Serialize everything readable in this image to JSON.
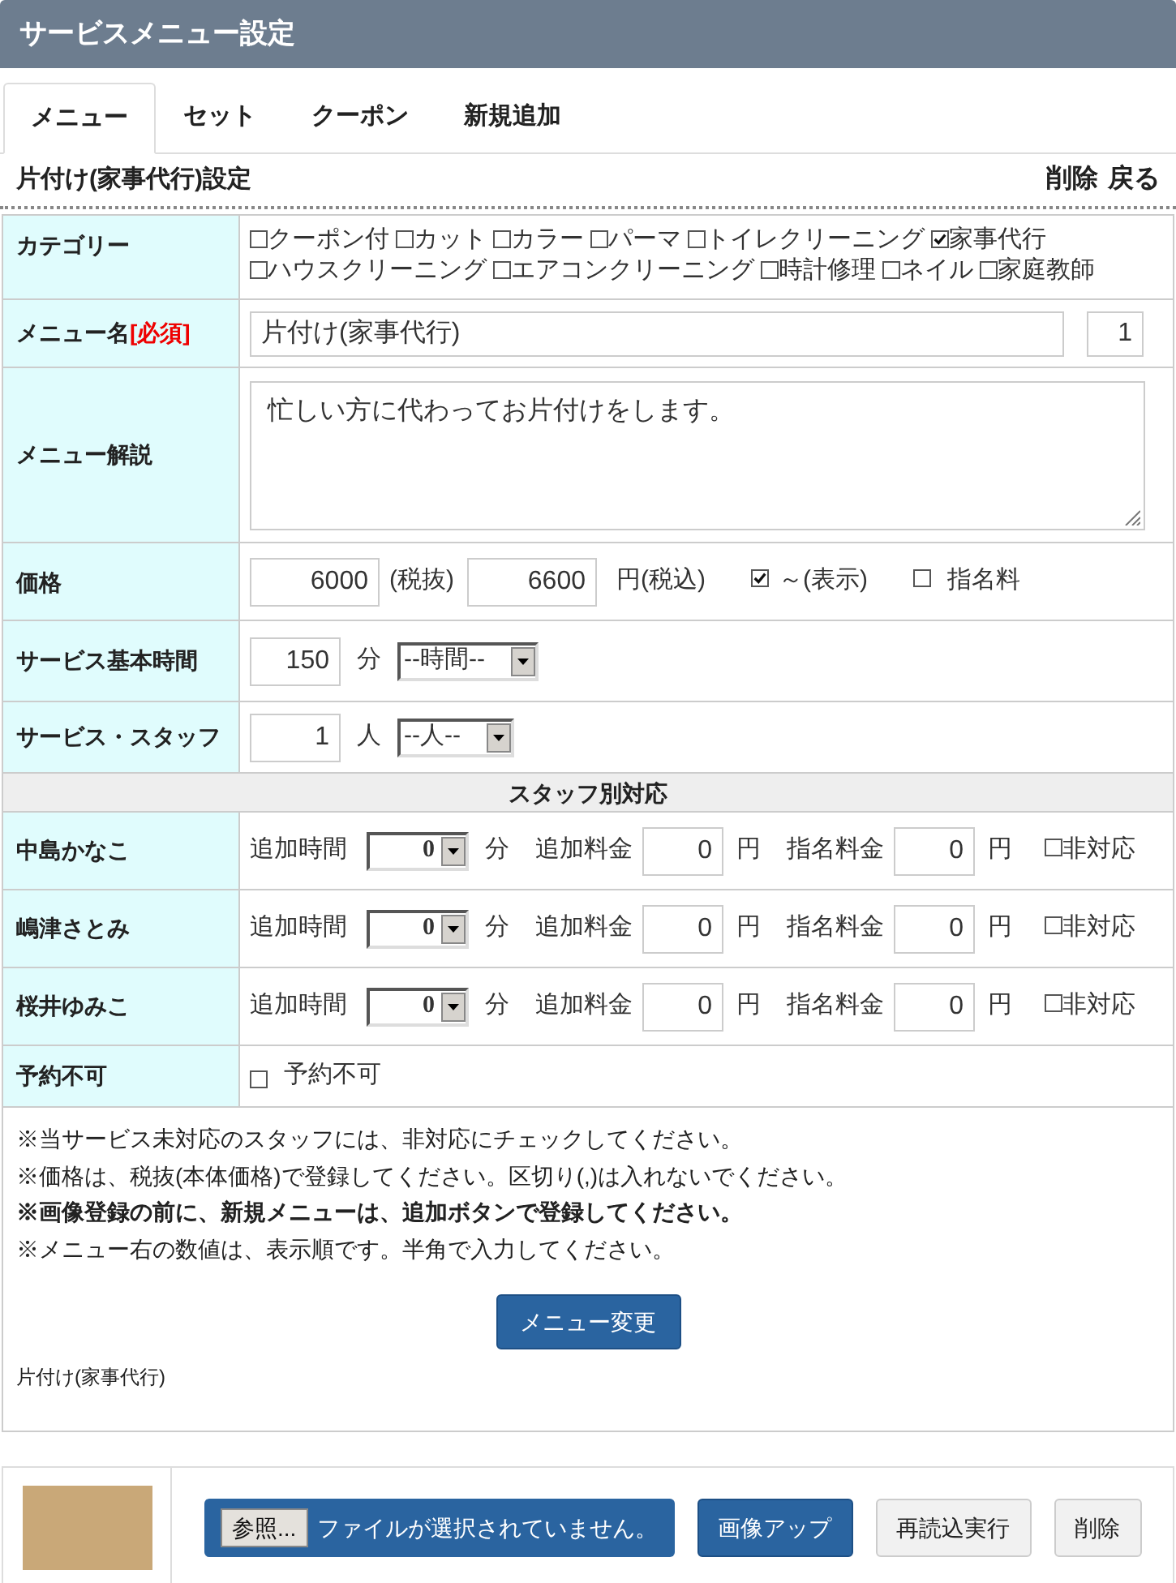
{
  "header": {
    "title": "サービスメニュー設定"
  },
  "tabs": [
    {
      "label": "メニュー",
      "selected": true
    },
    {
      "label": "セット",
      "selected": false
    },
    {
      "label": "クーポン",
      "selected": false
    },
    {
      "label": "新規追加",
      "selected": false
    }
  ],
  "section": {
    "title": "片付け(家事代行)設定",
    "actions": [
      "削除",
      "戻る"
    ]
  },
  "category": {
    "label": "カテゴリー",
    "options": [
      {
        "label": "クーポン付",
        "checked": false
      },
      {
        "label": "カット",
        "checked": false
      },
      {
        "label": "カラー",
        "checked": false
      },
      {
        "label": "パーマ",
        "checked": false
      },
      {
        "label": "トイレクリーニング",
        "checked": false
      },
      {
        "label": "家事代行",
        "checked": true
      },
      {
        "label": "ハウスクリーニング",
        "checked": false
      },
      {
        "label": "エアコンクリーニング",
        "checked": false
      },
      {
        "label": "時計修理",
        "checked": false
      },
      {
        "label": "ネイル",
        "checked": false
      },
      {
        "label": "家庭教師",
        "checked": false
      }
    ]
  },
  "menu_name": {
    "label": "メニュー名",
    "required_tag": "[必須]",
    "value": "片付け(家事代行)",
    "order": "1"
  },
  "description": {
    "label": "メニュー解説",
    "value": "忙しい方に代わってお片付けをします。"
  },
  "price": {
    "label": "価格",
    "excl_value": "6000",
    "excl_unit": "(税抜)",
    "incl_value": "6600",
    "incl_unit": "円(税込)",
    "range_display": {
      "label": "～(表示)",
      "checked": true
    },
    "nomination": {
      "label": "指名料",
      "checked": false
    }
  },
  "base_time": {
    "label": "サービス基本時間",
    "value": "150",
    "unit": "分",
    "select": "--時間--"
  },
  "staff_count": {
    "label": "サービス・スタッフ",
    "value": "1",
    "unit": "人",
    "select": "--人--"
  },
  "staff_heading": "スタッフ別対応",
  "staff_rows": [
    {
      "name": "中島かなこ",
      "time_label": "追加時間",
      "time_value": "0",
      "time_unit": "分",
      "fee_label": "追加料金",
      "fee_value": "0",
      "fee_unit": "円",
      "nom_label": "指名料金",
      "nom_value": "0",
      "nom_unit": "円",
      "unsupported": {
        "label": "非対応",
        "checked": false
      }
    },
    {
      "name": "嶋津さとみ",
      "time_label": "追加時間",
      "time_value": "0",
      "time_unit": "分",
      "fee_label": "追加料金",
      "fee_value": "0",
      "fee_unit": "円",
      "nom_label": "指名料金",
      "nom_value": "0",
      "nom_unit": "円",
      "unsupported": {
        "label": "非対応",
        "checked": false
      }
    },
    {
      "name": "桜井ゆみこ",
      "time_label": "追加時間",
      "time_value": "0",
      "time_unit": "分",
      "fee_label": "追加料金",
      "fee_value": "0",
      "fee_unit": "円",
      "nom_label": "指名料金",
      "nom_value": "0",
      "nom_unit": "円",
      "unsupported": {
        "label": "非対応",
        "checked": false
      }
    }
  ],
  "reservation": {
    "label": "予約不可",
    "option": {
      "label": "予約不可",
      "checked": false
    }
  },
  "notes": [
    {
      "text": "※当サービス未対応のスタッフには、非対応にチェックしてください。",
      "bold": false
    },
    {
      "text": "※価格は、税抜(本体価格)で登録してください。区切り(,)は入れないでください。",
      "bold": false
    },
    {
      "text": "※画像登録の前に、新規メニューは、追加ボタンで登録してください。",
      "bold": true
    },
    {
      "text": "※メニュー右の数値は、表示順です。半角で入力してください。",
      "bold": false
    }
  ],
  "submit": "メニュー変更",
  "caption": "片付け(家事代行)",
  "upload": {
    "browse": "参照...",
    "file_status": "ファイルが選択されていません。",
    "buttons": [
      {
        "label": "画像アップ",
        "kind": "primary"
      },
      {
        "label": "再読込実行",
        "kind": "secondary"
      },
      {
        "label": "削除",
        "kind": "secondary"
      }
    ]
  }
}
